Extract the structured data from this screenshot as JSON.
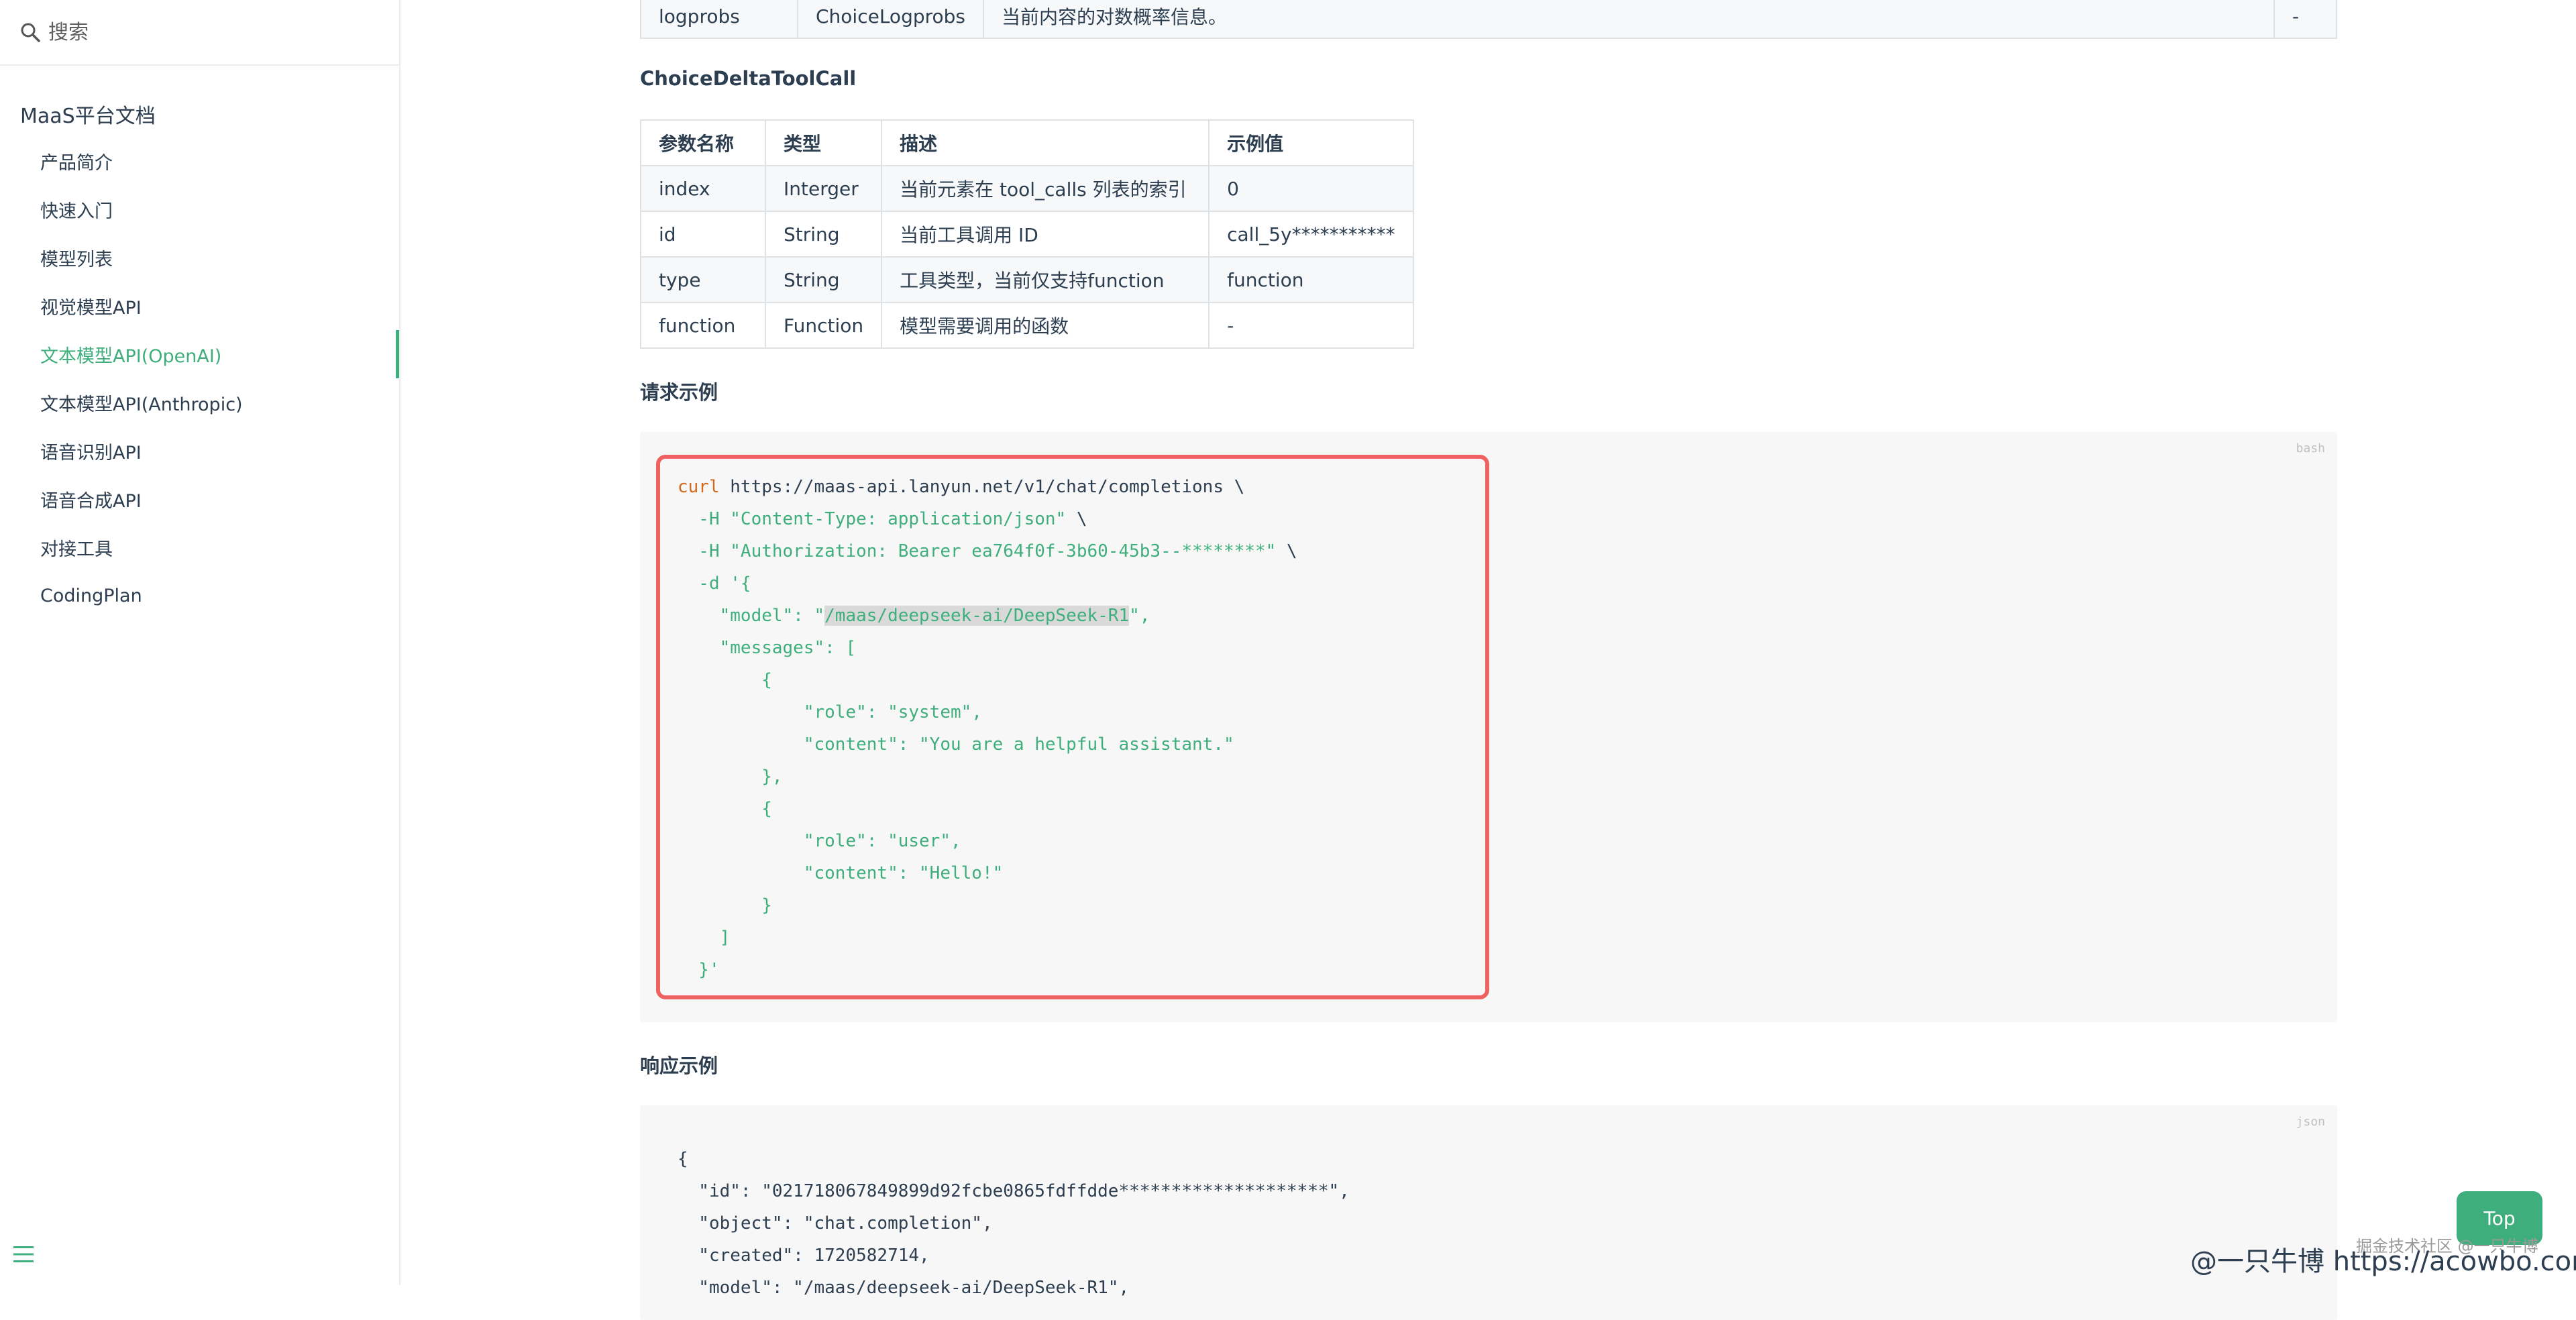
{
  "sidebar": {
    "search_placeholder": "搜索",
    "title": "MaaS平台文档",
    "items": [
      {
        "label": "产品简介"
      },
      {
        "label": "快速入门"
      },
      {
        "label": "模型列表"
      },
      {
        "label": "视觉模型API"
      },
      {
        "label": "文本模型API(OpenAI)",
        "active": true
      },
      {
        "label": "文本模型API(Anthropic)"
      },
      {
        "label": "语音识别API"
      },
      {
        "label": "语音合成API"
      },
      {
        "label": "对接工具"
      },
      {
        "label": "CodingPlan"
      }
    ]
  },
  "top_table_row": [
    "logprobs",
    "ChoiceLogprobs",
    "当前内容的对数概率信息。",
    "-"
  ],
  "tool_call_section": {
    "heading": "ChoiceDeltaToolCall",
    "headers": [
      "参数名称",
      "类型",
      "描述",
      "示例值"
    ],
    "rows": [
      [
        "index",
        "Interger",
        "当前元素在 tool_calls 列表的索引",
        "0"
      ],
      [
        "id",
        "String",
        "当前工具调用 ID",
        "call_5y***********"
      ],
      [
        "type",
        "String",
        "工具类型，当前仅支持function",
        "function"
      ],
      [
        "function",
        "Function",
        "模型需要调用的函数",
        "-"
      ]
    ]
  },
  "request_example": {
    "heading": "请求示例",
    "lang": "bash",
    "lines": {
      "l1_cmd": "curl",
      "l1_rest": " https://maas-api.lanyun.net/v1/chat/completions \\",
      "l2_flag": "  -H",
      "l2_str": " \"Content-Type: application/json\"",
      "l2_tail": " \\",
      "l3_flag": "  -H",
      "l3_str": " \"Authorization: Bearer ea764f0f-3b60-45b3--********\"",
      "l3_tail": " \\",
      "l4_flag": "  -d",
      "l4_str": " '{",
      "l5_a": "    \"model\": \"",
      "l5_hl": "/maas/deepseek-ai/DeepSeek-R1",
      "l5_b": "\",",
      "l6": "    \"messages\": [",
      "l7": "        {",
      "l8": "            \"role\": \"system\",",
      "l9": "            \"content\": \"You are a helpful assistant.\"",
      "l10": "        },",
      "l11": "        {",
      "l12": "            \"role\": \"user\",",
      "l13": "            \"content\": \"Hello!\"",
      "l14": "        }",
      "l15": "    ]",
      "l16": "  }'"
    }
  },
  "response_example": {
    "heading": "响应示例",
    "lang": "json",
    "lines": [
      "{",
      "  \"id\": \"021718067849899d92fcbe0865fdffdde********************\",",
      "  \"object\": \"chat.completion\",",
      "  \"created\": 1720582714,",
      "  \"model\": \"/maas/deepseek-ai/DeepSeek-R1\","
    ]
  },
  "top_button": "Top",
  "watermark": {
    "small": "掘金技术社区 @一只牛博",
    "main": "@一只牛博 https://acowbo.com"
  },
  "colors": {
    "accent": "#3eaf7c",
    "highlight_frame": "#ee6262"
  }
}
